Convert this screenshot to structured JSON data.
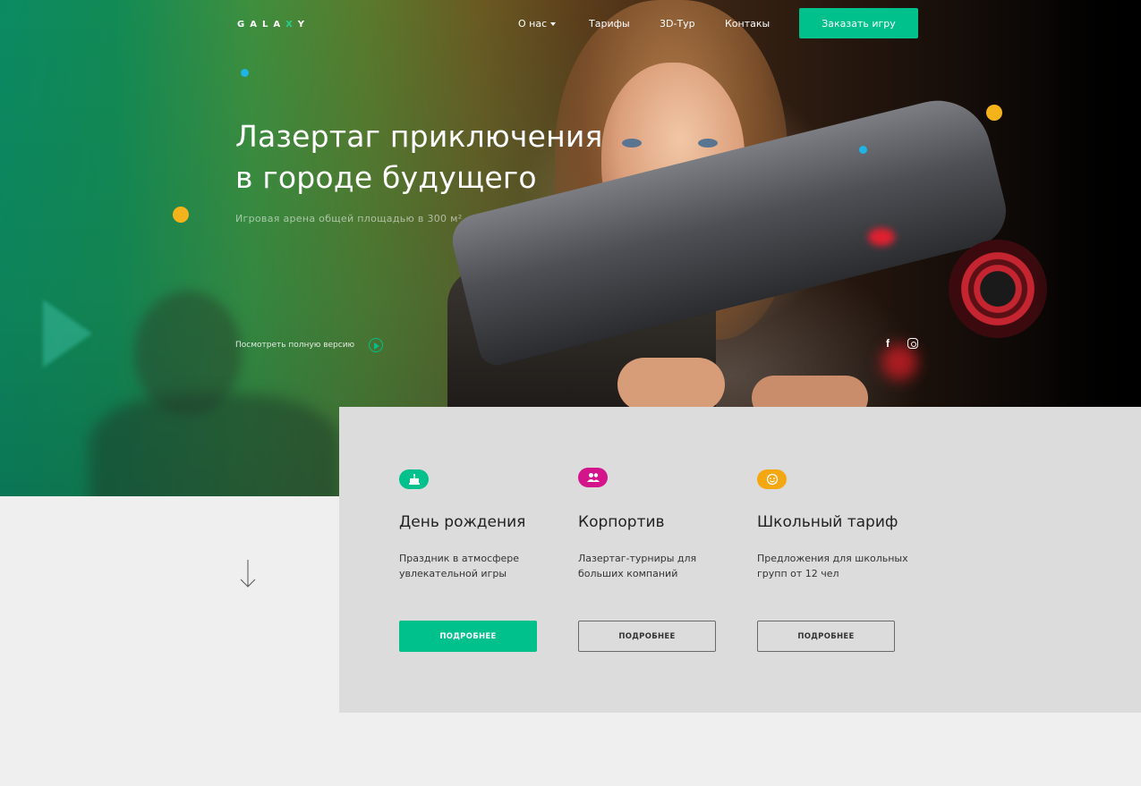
{
  "header": {
    "logo": {
      "pre": "GALA",
      "x": "X",
      "post": "Y"
    },
    "nav": [
      {
        "label": "О нас",
        "has_dropdown": true
      },
      {
        "label": "Тарифы",
        "has_dropdown": false
      },
      {
        "label": "3D-Тур",
        "has_dropdown": false
      },
      {
        "label": "Контакы",
        "has_dropdown": false
      }
    ],
    "order_button": "Заказать игру"
  },
  "hero": {
    "title_line1": "Лазертаг приключения",
    "title_line2": "в городе будущего",
    "subtitle": "Игровая арена общей площадью в 300 м²",
    "video_link": "Посмотреть полную версию",
    "social": [
      {
        "icon": "facebook-icon",
        "label": "f"
      },
      {
        "icon": "instagram-icon",
        "label": ""
      }
    ]
  },
  "features": [
    {
      "icon": "cake-icon",
      "icon_color": "#00c08b",
      "title": "День рождения",
      "desc": "Праздник в атмосфере увлекательной игры",
      "button": "ПОДРОБНЕЕ",
      "button_style": "filled"
    },
    {
      "icon": "group-icon",
      "icon_color": "#d4148a",
      "title": "Корпортив",
      "desc": "Лазертаг-турниры для больших компаний",
      "button": "ПОДРОБНЕЕ",
      "button_style": "outline"
    },
    {
      "icon": "smile-face-icon",
      "icon_color": "#f5a712",
      "title": "Школьный тариф",
      "desc": "Предложения для школьных групп от 12 чел",
      "button": "ПОДРОБНЕЕ",
      "button_style": "outline"
    }
  ],
  "colors": {
    "accent": "#00c08b",
    "magenta": "#d4148a",
    "orange": "#f5a712",
    "dot_blue": "#1fb3e6",
    "dot_orange": "#f5b31b",
    "panel_bg": "#dcdcdc",
    "page_bg": "#efefef"
  }
}
